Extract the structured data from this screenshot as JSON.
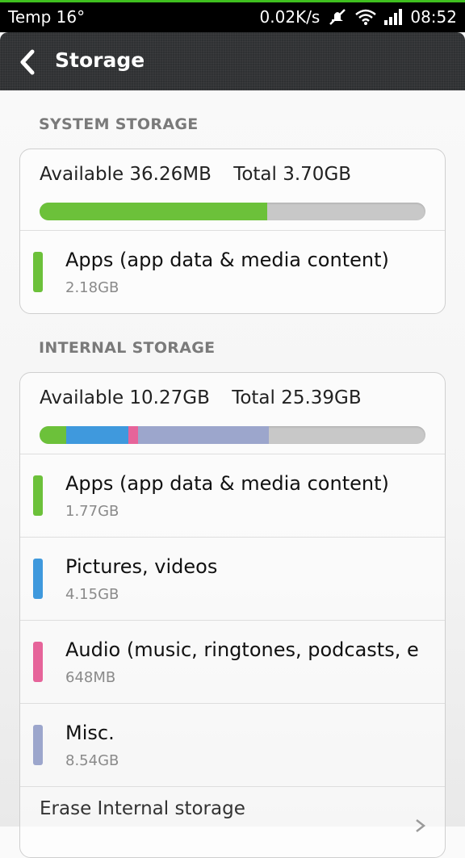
{
  "status_bar": {
    "left_text": "Temp  16°",
    "speed": "0.02K/s",
    "time": "08:52"
  },
  "header": {
    "title": "Storage"
  },
  "system_storage": {
    "section_title": "SYSTEM STORAGE",
    "available": "Available 36.26MB",
    "total": "Total 3.70GB",
    "usage_fractions": {
      "apps": 0.59
    },
    "items": [
      {
        "label": "Apps (app data & media content)",
        "size": "2.18GB",
        "color": "#6cc13a"
      }
    ]
  },
  "internal_storage": {
    "section_title": "INTERNAL STORAGE",
    "available": "Available 10.27GB",
    "total": "Total 25.39GB",
    "usage_fractions": {
      "apps": 0.07,
      "pictures": 0.16,
      "audio": 0.025,
      "misc": 0.34
    },
    "items": [
      {
        "label": "Apps (app data & media content)",
        "size": "1.77GB",
        "color": "#6cc13a"
      },
      {
        "label": "Pictures, videos",
        "size": "4.15GB",
        "color": "#3f99dd"
      },
      {
        "label": "Audio (music, ringtones, podcasts, e",
        "size": "648MB",
        "color": "#e6649a"
      },
      {
        "label": "Misc.",
        "size": "8.54GB",
        "color": "#9ca6cc"
      }
    ],
    "erase_label": "Erase Internal storage"
  },
  "colors": {
    "bar_empty": "#c8c8c8",
    "header_bg": "#2f3133"
  }
}
